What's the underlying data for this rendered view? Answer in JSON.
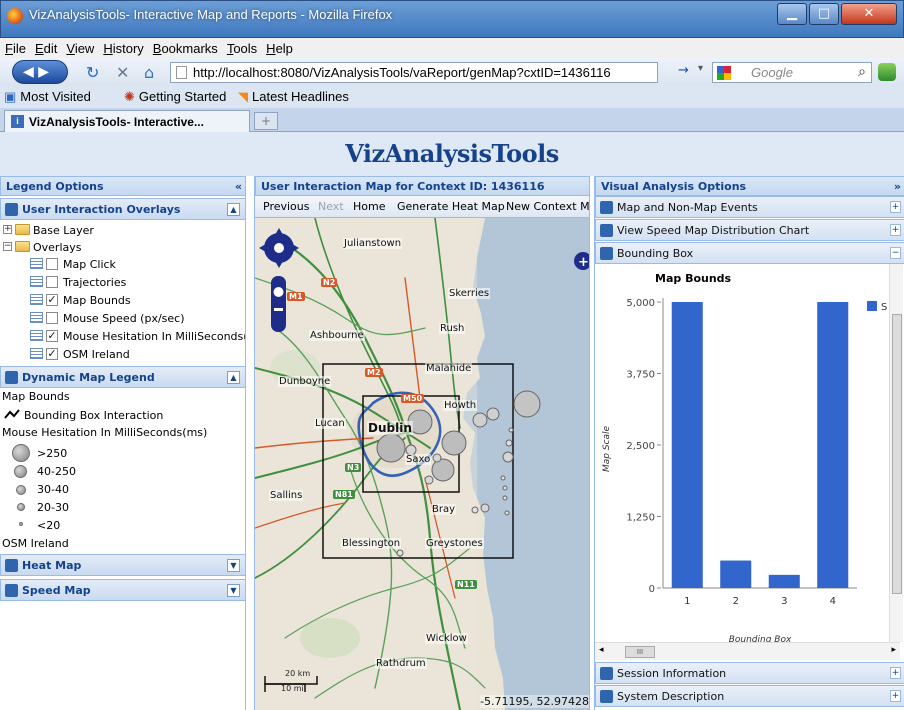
{
  "window": {
    "title": "VizAnalysisTools- Interactive Map and Reports - Mozilla Firefox"
  },
  "menu": [
    "File",
    "Edit",
    "View",
    "History",
    "Bookmarks",
    "Tools",
    "Help"
  ],
  "navbar": {
    "url": "http://localhost:8080/VizAnalysisTools/vaReport/genMap?cxtID=1436116",
    "search_placeholder": "Google"
  },
  "bookmarks": [
    "Most Visited",
    "Getting Started",
    "Latest Headlines"
  ],
  "tab": {
    "label": "VizAnalysisTools- Interactive...",
    "new_tab": "+"
  },
  "app": {
    "title": "VizAnalysisTools"
  },
  "west": {
    "header": "Legend Options",
    "overlays_panel": "User Interaction Overlays",
    "tree": {
      "base_layer": "Base Layer",
      "overlays": "Overlays",
      "items": [
        {
          "label": "Map Click",
          "checked": false
        },
        {
          "label": "Trajectories",
          "checked": false
        },
        {
          "label": "Map Bounds",
          "checked": true
        },
        {
          "label": "Mouse Speed (px/sec)",
          "checked": false
        },
        {
          "label": "Mouse Hesitation In MilliSeconds(ms",
          "checked": true
        },
        {
          "label": "OSM Ireland",
          "checked": true
        }
      ]
    },
    "legend_panel": "Dynamic Map Legend",
    "legend": {
      "map_bounds": "Map Bounds",
      "bbox_interaction": "Bounding Box Interaction",
      "hesitation_title": "Mouse Hesitation In MilliSeconds(ms)",
      "classes": [
        ">250",
        "40-250",
        "30-40",
        "20-30",
        "<20"
      ],
      "osm": "OSM Ireland"
    },
    "heat_panel": "Heat Map",
    "speed_panel": "Speed Map"
  },
  "center": {
    "header": "User Interaction Map for Context ID: 1436116",
    "toolbar": [
      "Previous",
      "Next",
      "Home",
      "Generate Heat Map",
      "New Context Map"
    ],
    "places": [
      "Julianstown",
      "Skerries",
      "Rush",
      "Ashbourne",
      "Malahide",
      "Dunboyne",
      "Howth",
      "Lucan",
      "Dublin",
      "Saxo",
      "Sallins",
      "Bray",
      "Blessington",
      "Greystones",
      "Wicklow",
      "Rathdrum"
    ],
    "roads": [
      "M1",
      "N2",
      "M2",
      "M50",
      "N81",
      "N11",
      "N3"
    ],
    "scale_km": "20 km",
    "scale_mi": "10 mi",
    "coords": "-5.71195, 52.97428"
  },
  "east": {
    "header": "Visual Analysis Options",
    "items": [
      {
        "label": "Map and Non-Map Events",
        "toggle": "+"
      },
      {
        "label": "View Speed Map Distribution Chart",
        "toggle": "+"
      },
      {
        "label": "Bounding Box",
        "toggle": "−"
      }
    ],
    "bottom_items": [
      {
        "label": "Session Information",
        "toggle": "+"
      },
      {
        "label": "System Description",
        "toggle": "+"
      }
    ]
  },
  "chart_data": {
    "type": "bar",
    "title": "Map Bounds",
    "xlabel": "Bounding Box",
    "ylabel": "Map Scale",
    "categories": [
      "1",
      "2",
      "3",
      "4"
    ],
    "series": [
      {
        "name": "S",
        "values": [
          5000,
          480,
          230,
          5000
        ],
        "color": "#3366cc"
      }
    ],
    "ylim": [
      0,
      5000
    ],
    "yticks": [
      "0",
      "1,250",
      "2,500",
      "3,750",
      "5,000"
    ],
    "legend_position": "right"
  },
  "colors": {
    "accent": "#15428b",
    "bar": "#3366cc",
    "panel_border": "#99bbe8"
  }
}
